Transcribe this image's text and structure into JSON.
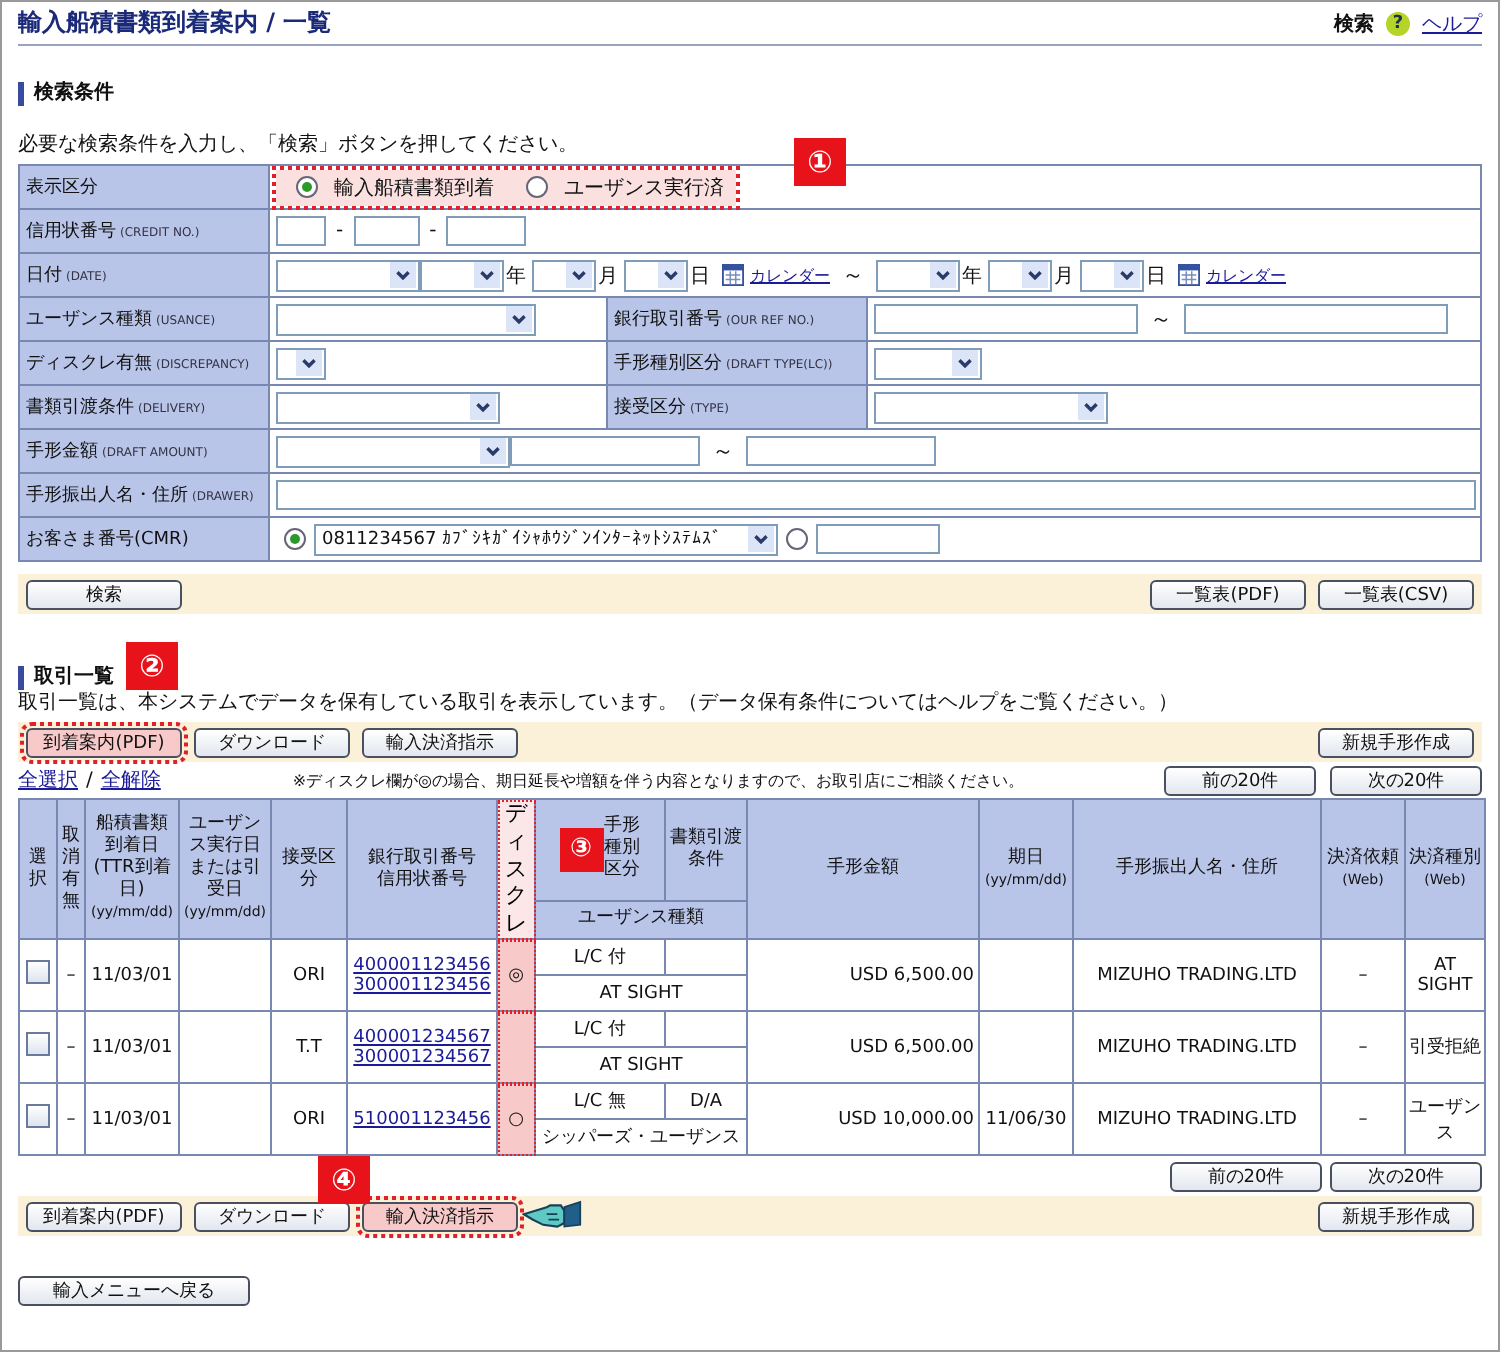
{
  "header": {
    "title": "輸入船積書類到着案内 / 一覧",
    "search_label": "検索",
    "help_mark": "?",
    "help_link": "ヘルプ"
  },
  "search": {
    "heading": "検索条件",
    "instruction": "必要な検索条件を入力し、「検索」ボタンを押してください。",
    "callout": "①",
    "display": {
      "label": "表示区分",
      "options": [
        {
          "label": "輸入船積書類到着",
          "selected": true
        },
        {
          "label": "ユーザンス実行済",
          "selected": false
        }
      ]
    },
    "credit": {
      "label": "信用状番号",
      "sublabel": "(CREDIT NO.)",
      "separators": [
        "-",
        "-"
      ]
    },
    "date": {
      "label": "日付",
      "sublabel": "(DATE)",
      "ranges": [
        {
          "year": "年",
          "month": "月",
          "day": "日",
          "calendar": "カレンダー"
        },
        {
          "year": "年",
          "month": "月",
          "day": "日",
          "calendar": "カレンダー"
        }
      ],
      "range_sep": "～"
    },
    "usance": {
      "label": "ユーザンス種類",
      "sublabel": "(USANCE)"
    },
    "ref": {
      "label": "銀行取引番号",
      "sublabel": "(OUR REF NO.)",
      "range_sep": "～"
    },
    "discrepancy": {
      "label": "ディスクレ有無",
      "sublabel": "(DISCREPANCY)"
    },
    "draft_type": {
      "label": "手形種別区分",
      "sublabel": "(DRAFT TYPE(LC))"
    },
    "delivery": {
      "label": "書類引渡条件",
      "sublabel": "(DELIVERY)"
    },
    "type": {
      "label": "接受区分",
      "sublabel": "(TYPE)"
    },
    "amount": {
      "label": "手形金額",
      "sublabel": "(DRAFT AMOUNT)",
      "range_sep": "～"
    },
    "drawer": {
      "label": "手形振出人名・住所",
      "sublabel": "(DRAWER)"
    },
    "cmr": {
      "label": "お客さま番号(CMR)",
      "options": [
        {
          "selected": true,
          "value": "0811234567 ｶﾌﾞｼｷｶﾞｲｼｬﾎｳｼﾞﾝｲﾝﾀｰﾈｯﾄｼｽﾃﾑｽﾞ"
        },
        {
          "selected": false
        }
      ]
    },
    "search_button": "検索",
    "export_buttons": [
      "一覧表(PDF)",
      "一覧表(CSV)"
    ]
  },
  "list": {
    "heading": "取引一覧",
    "callout": "②",
    "description": "取引一覧は、本システムでデータを保有している取引を表示しています。（データ保有条件についてはヘルプをご覧ください。）",
    "toolbar": {
      "buttons": [
        {
          "label": "到着案内(PDF)",
          "highlighted": true
        },
        {
          "label": "ダウンロード",
          "highlighted": false
        },
        {
          "label": "輸入決済指示",
          "highlighted": false
        }
      ],
      "new_button": "新規手形作成"
    },
    "select_all": "全選択",
    "slash": "/",
    "deselect_all": "全解除",
    "note": "※ディスクレ欄が◎の場合、期日延長や増額を伴う内容となりますので、お取引店にご相談ください。",
    "pager": [
      "前の20件",
      "次の20件"
    ],
    "columns": {
      "select": "選択",
      "cancel": "取消有無",
      "arrival": "船積書類到着日(TTR到着日)",
      "arrival_unit": "(yy/mm/dd)",
      "usance_date": "ユーザンス実行日または引受日",
      "usance_date_unit": "(yy/mm/dd)",
      "type": "接受区分",
      "refs": [
        "銀行取引番号",
        "信用状番号"
      ],
      "discrepancy": "ディスクレ",
      "discrepancy_highlighted": true,
      "callout": "③",
      "draft_type": "手形種別区分",
      "delivery": "書類引渡条件",
      "usance": "ユーザンス種類",
      "amount": "手形金額",
      "maturity": "期日",
      "maturity_unit": "(yy/mm/dd)",
      "drawer": "手形振出人名・住所",
      "request": "決済依頼",
      "request_unit": "(Web)",
      "settlement": "決済種別",
      "settlement_unit": "(Web)"
    },
    "rows": [
      {
        "checked": false,
        "cancel": "–",
        "arrival": "11/03/01",
        "type": "ORI",
        "refs": [
          "400001123456",
          "300001123456"
        ],
        "discrepancy": "◎",
        "draft_type": "L/C 付",
        "usance": "AT SIGHT",
        "amount": "USD 6,500.00",
        "drawer": "MIZUHO TRADING.LTD",
        "request": "–",
        "settlement": "AT SIGHT"
      },
      {
        "checked": false,
        "cancel": "–",
        "arrival": "11/03/01",
        "type": "T.T",
        "refs": [
          "400001234567",
          "300001234567"
        ],
        "draft_type": "L/C 付",
        "usance": "AT SIGHT",
        "amount": "USD 6,500.00",
        "drawer": "MIZUHO TRADING.LTD",
        "request": "–",
        "settlement": "引受拒絶"
      },
      {
        "checked": false,
        "cancel": "–",
        "arrival": "11/03/01",
        "type": "ORI",
        "refs": [
          "510001123456"
        ],
        "discrepancy": "○",
        "draft_type": "L/C 無",
        "delivery": "D/A",
        "usance": "シッパーズ・ユーザンス",
        "amount": "USD 10,000.00",
        "maturity": "11/06/30",
        "drawer": "MIZUHO TRADING.LTD",
        "request": "–",
        "settlement": "ユーザンス"
      }
    ],
    "pager_bottom": [
      "前の20件",
      "次の20件"
    ],
    "toolbar_bottom": {
      "callout": "④",
      "buttons": [
        {
          "label": "到着案内(PDF)",
          "highlighted": false
        },
        {
          "label": "ダウンロード",
          "highlighted": false
        },
        {
          "label": "輸入決済指示",
          "highlighted": true
        }
      ],
      "new_button": "新規手形作成"
    }
  },
  "back_button": "輸入メニューへ戻る"
}
